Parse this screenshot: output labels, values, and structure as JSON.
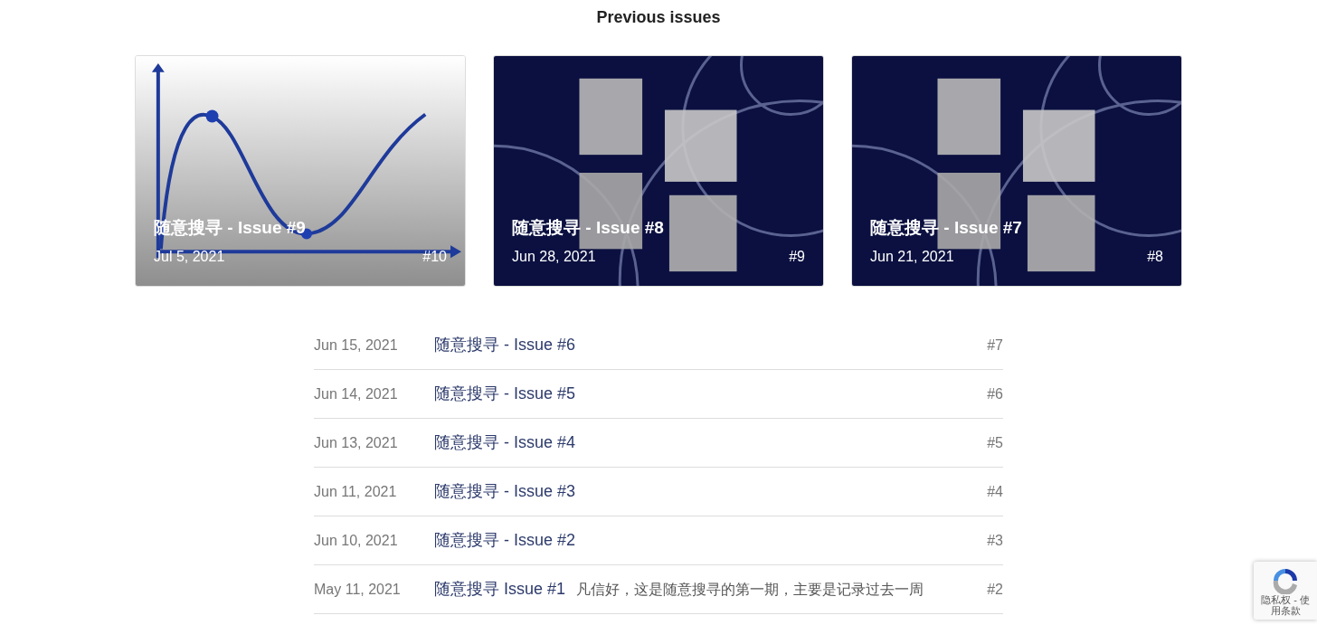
{
  "heading": "Previous issues",
  "cards": [
    {
      "title": "随意搜寻 - Issue #9",
      "date": "Jul 5, 2021",
      "number": "#10",
      "kind": "chart"
    },
    {
      "title": "随意搜寻 - Issue #8",
      "date": "Jun 28, 2021",
      "number": "#9",
      "kind": "cover"
    },
    {
      "title": "随意搜寻 - Issue #7",
      "date": "Jun 21, 2021",
      "number": "#8",
      "kind": "cover"
    }
  ],
  "rows": [
    {
      "date": "Jun 15, 2021",
      "title": "随意搜寻 - Issue #6",
      "number": "#7"
    },
    {
      "date": "Jun 14, 2021",
      "title": "随意搜寻 - Issue #5",
      "number": "#6"
    },
    {
      "date": "Jun 13, 2021",
      "title": "随意搜寻 - Issue #4",
      "number": "#5"
    },
    {
      "date": "Jun 11, 2021",
      "title": "随意搜寻 - Issue #3",
      "number": "#4"
    },
    {
      "date": "Jun 10, 2021",
      "title": "随意搜寻 - Issue #2",
      "number": "#3"
    },
    {
      "date": "May 11, 2021",
      "title": "随意搜寻 Issue #1",
      "excerpt": "凡信好，这是随意搜寻的第一期，主要是记录过去一周",
      "number": "#2"
    }
  ],
  "recaptcha": {
    "line_1": "隐私权 - 使",
    "line_2": "用条款"
  }
}
